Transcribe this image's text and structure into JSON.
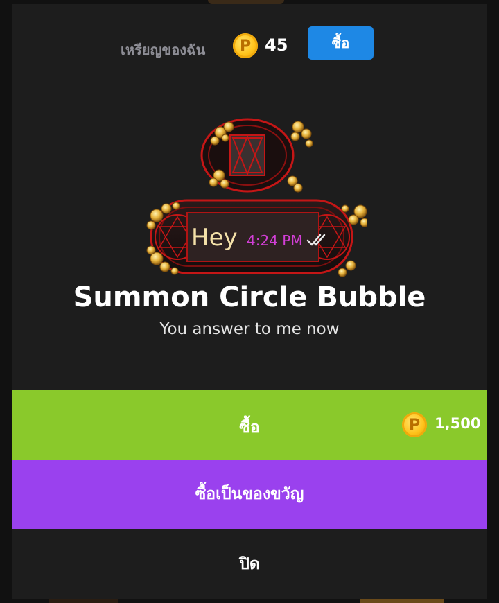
{
  "header": {
    "coin_label": "เหรียญของฉัน",
    "coin_symbol": "P",
    "coin_balance": "45",
    "buy_label": "ซื้อ"
  },
  "preview": {
    "message_text": "Hey",
    "message_time": "4:24 PM"
  },
  "item": {
    "title": "Summon Circle Bubble",
    "subtitle": "You answer to me now"
  },
  "actions": {
    "buy_label": "ซื้อ",
    "price_symbol": "P",
    "price": "1,500",
    "gift_label": "ซื้อเป็นของขวัญ",
    "close_label": "ปิด"
  },
  "colors": {
    "buy_green": "#8ac92b",
    "gift_purple": "#9a41ee",
    "header_buy_blue": "#1e88e5",
    "coin_gold": "#ffc21a",
    "time_magenta": "#d23fd6"
  }
}
